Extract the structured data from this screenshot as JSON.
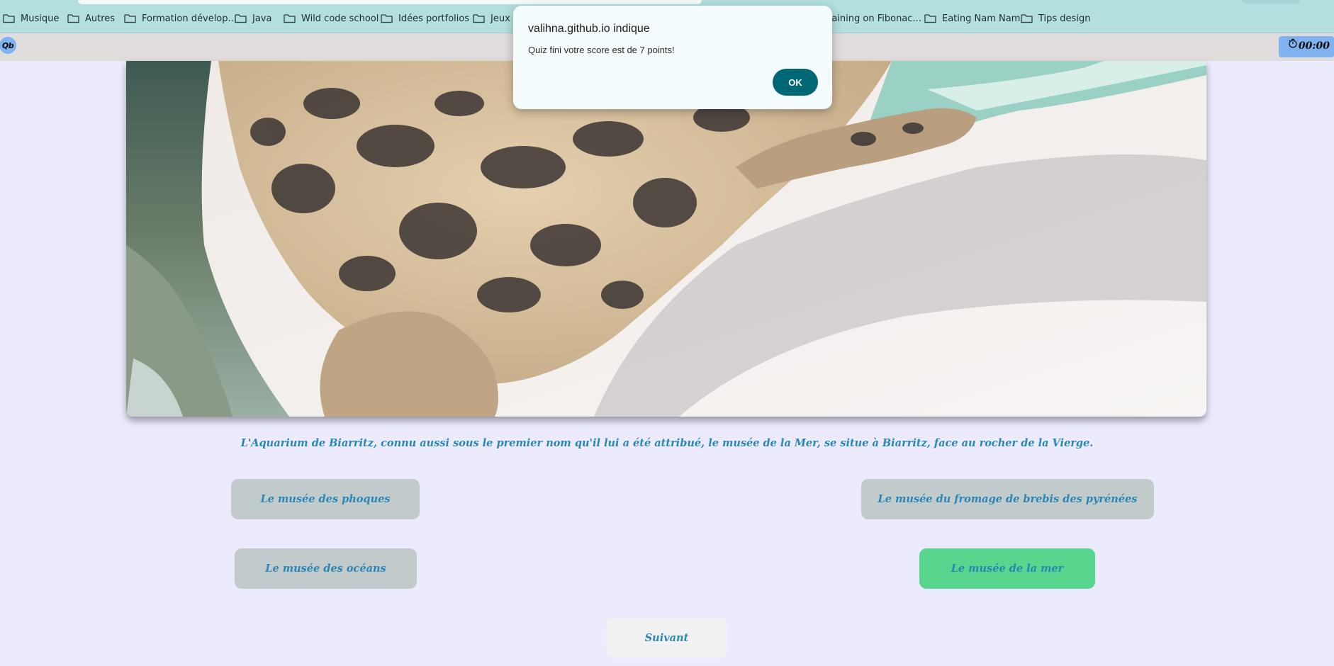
{
  "bookmarks": [
    {
      "label": "Musique",
      "icon": "folder-icon"
    },
    {
      "label": "Autres",
      "icon": "folder-icon"
    },
    {
      "label": "Formation dévelop...",
      "icon": "folder-icon"
    },
    {
      "label": "Java",
      "icon": "folder-icon"
    },
    {
      "label": "Wild code school",
      "icon": "folder-icon"
    },
    {
      "label": "Idées portfolios",
      "icon": "folder-icon"
    },
    {
      "label": "Jeux à",
      "icon": "folder-icon"
    },
    {
      "label": "raining on Fibonac...",
      "icon": "folder-icon"
    },
    {
      "label": "Eating Nam Nam",
      "icon": "folder-icon"
    },
    {
      "label": "Tips design",
      "icon": "folder-icon"
    }
  ],
  "toolbar": {
    "logo_text": "Qb",
    "timer": "00:00"
  },
  "hero": {
    "subject": "seal lying on sand"
  },
  "quiz": {
    "caption": "L'Aquarium de Biarritz, connu aussi sous le premier nom qu'il lui a été attribué, le musée de la Mer, se situe à Biarritz, face au rocher de la Vierge.",
    "answers": [
      {
        "label": "Le musée des phoques",
        "correct": false
      },
      {
        "label": "Le musée du fromage de brebis des pyrénées",
        "correct": false
      },
      {
        "label": "Le musée des océans",
        "correct": false
      },
      {
        "label": "Le musée de la mer",
        "correct": true
      }
    ],
    "next_label": "Suivant"
  },
  "dialog": {
    "title": "valihna.github.io indique",
    "message": "Quiz fini votre score est de 7 points!",
    "ok_label": "OK"
  },
  "colors": {
    "bookmarks_bg": "#b3dfdf",
    "page_bg": "#ecebfd",
    "text_accent": "#2a86b5",
    "answer_bg": "#c1cbcb",
    "answer_correct_bg": "#58d68e",
    "dialog_ok_bg": "#006874"
  }
}
